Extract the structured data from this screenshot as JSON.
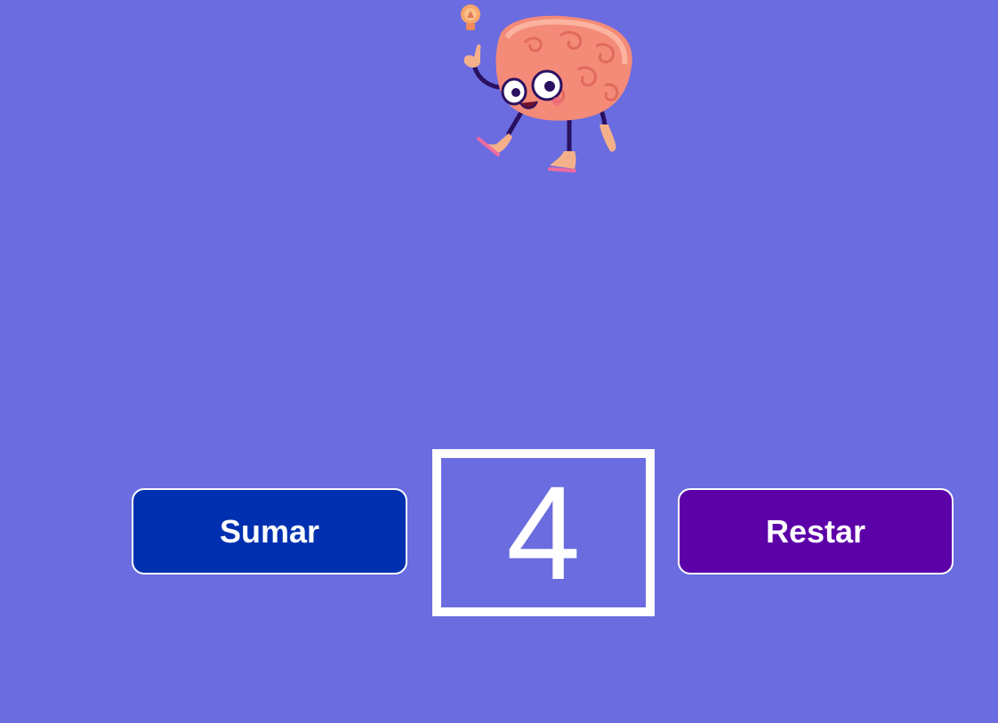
{
  "mascot": {
    "icon": "brain-character-icon"
  },
  "counter": {
    "value": "4",
    "add_label": "Sumar",
    "subtract_label": "Restar"
  },
  "colors": {
    "background": "#6a6ce0",
    "add_button": "#0030b0",
    "subtract_button": "#5c00a8",
    "text": "#ffffff"
  }
}
